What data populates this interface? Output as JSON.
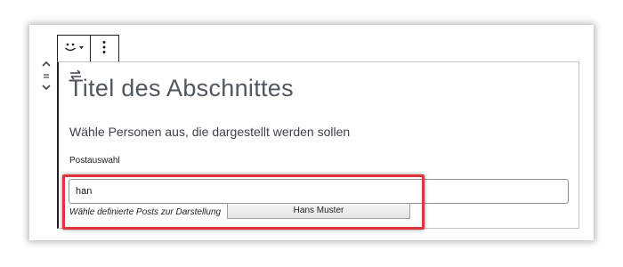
{
  "block_toolbar": {
    "block_icon": "smiley-icon",
    "options_icon": "vertical-ellipsis-icon"
  },
  "mover": {
    "up_icon": "chevron-up-icon",
    "drag_icon": "drag-handle-icon",
    "down_icon": "chevron-down-icon"
  },
  "block": {
    "title": "Titel des Abschnittes",
    "description": "Wähle Personen aus, die dargestellt werden sollen",
    "field_label": "Postauswahl",
    "input_value": "han",
    "hint": "Wähle definierte Posts zur Darstellung",
    "suggestion": "Hans Muster"
  },
  "colors": {
    "highlight": "#e0363b",
    "title": "#50575e"
  }
}
